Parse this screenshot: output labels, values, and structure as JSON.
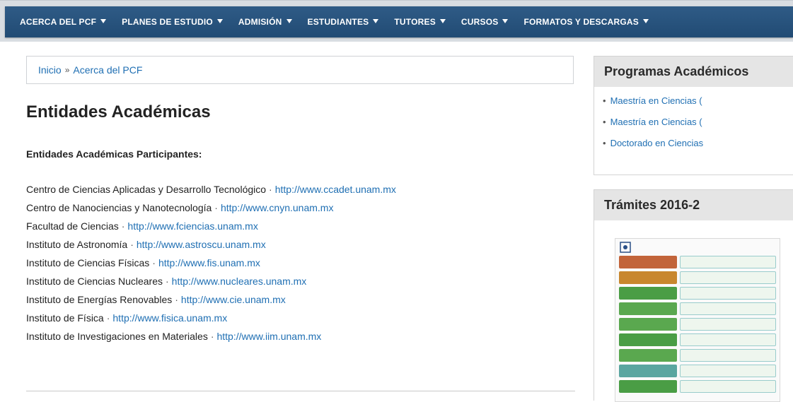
{
  "nav": {
    "items": [
      {
        "label": "ACERCA DEL PCF"
      },
      {
        "label": "PLANES DE ESTUDIO"
      },
      {
        "label": "ADMISIÓN"
      },
      {
        "label": "ESTUDIANTES"
      },
      {
        "label": "TUTORES"
      },
      {
        "label": "CURSOS"
      },
      {
        "label": "FORMATOS Y DESCARGAS"
      }
    ]
  },
  "breadcrumb": {
    "home": "Inicio",
    "separator": "»",
    "current": "Acerca del PCF"
  },
  "page": {
    "title": "Entidades Académicas",
    "subtitle": "Entidades Académicas Participantes:"
  },
  "entities": [
    {
      "name": "Centro de Ciencias Aplicadas y Desarrollo Tecnológico",
      "url": "http://www.ccadet.unam.mx"
    },
    {
      "name": "Centro de Nanociencias y Nanotecnología",
      "url": "http://www.cnyn.unam.mx"
    },
    {
      "name": "Facultad de Ciencias",
      "url": "http://www.fciencias.unam.mx"
    },
    {
      "name": "Instituto de Astronomía",
      "url": "http://www.astroscu.unam.mx"
    },
    {
      "name": "Instituto de Ciencias Físicas",
      "url": "http://www.fis.unam.mx"
    },
    {
      "name": "Instituto de Ciencias Nucleares",
      "url": "http://www.nucleares.unam.mx"
    },
    {
      "name": "Instituto de Energías Renovables",
      "url": "http://www.cie.unam.mx"
    },
    {
      "name": "Instituto de Física",
      "url": "http://www.fisica.unam.mx"
    },
    {
      "name": "Instituto de Investigaciones en Materiales",
      "url": "http://www.iim.unam.mx"
    }
  ],
  "entity_separator": "·",
  "sidebar": {
    "programs": {
      "title": "Programas Académicos",
      "items": [
        {
          "label": "Maestría en Ciencias ("
        },
        {
          "label": "Maestría en Ciencias ("
        },
        {
          "label": "Doctorado en Ciencias"
        }
      ]
    },
    "tramites": {
      "title": "Trámites 2016-2"
    }
  },
  "colors": {
    "nav_bg": "#2a5580",
    "link": "#1f6fb3",
    "sidebar_head": "#e5e5e5"
  }
}
